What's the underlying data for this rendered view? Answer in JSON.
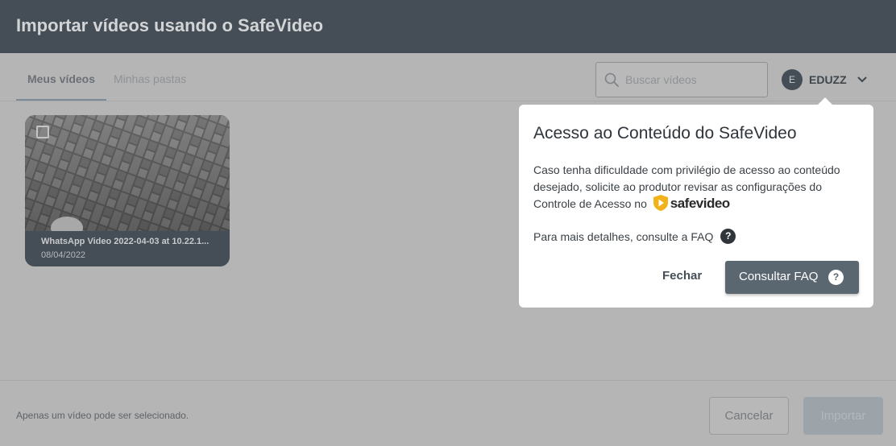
{
  "header": {
    "title": "Importar vídeos usando o SafeVideo"
  },
  "tabs": [
    {
      "label": "Meus vídeos",
      "active": true
    },
    {
      "label": "Minhas pastas",
      "active": false
    }
  ],
  "search": {
    "placeholder": "Buscar vídeos",
    "icon": "search-icon"
  },
  "account": {
    "initial": "E",
    "name": "EDUZZ",
    "icon": "chevron-down-icon"
  },
  "videos": [
    {
      "title": "WhatsApp Video 2022-04-03 at 10.22.1...",
      "date": "08/04/2022"
    }
  ],
  "footer": {
    "note": "Apenas um vídeo pode ser selecionado.",
    "cancel_label": "Cancelar",
    "import_label": "Importar"
  },
  "popover": {
    "title": "Acesso ao Conteúdo do SafeVideo",
    "body": "Caso tenha dificuldade com privilégio de acesso ao conteúdo desejado, solicite ao produtor revisar as configurações do Controle de Acesso no",
    "brand": "safevideo",
    "faq_text": "Para mais detalhes, consulte a FAQ",
    "help_glyph": "?",
    "close_label": "Fechar",
    "faq_button_label": "Consultar FAQ"
  },
  "colors": {
    "header": "#454e56",
    "overlay_background": "#b5b5b5",
    "primary_button": "#5a6670",
    "brand_shield": "#f2b21a"
  }
}
